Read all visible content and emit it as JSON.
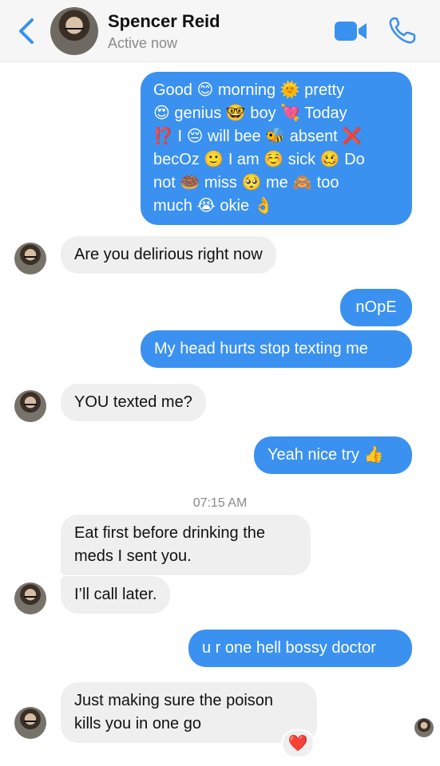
{
  "header": {
    "name": "Spencer Reid",
    "status": "Active now"
  },
  "colors": {
    "accent": "#3a91f0",
    "sent_bubble": "#3a91f0",
    "received_bubble": "#efefef",
    "header_bg": "#f6f6f6",
    "reaction": "#e0282c"
  },
  "icons": {
    "back": "chevron-left-icon",
    "video": "video-camera-icon",
    "call": "phone-icon",
    "reaction": "heart-icon"
  },
  "messages": {
    "m1": {
      "line1": "Good 😊 morning 🌞 pretty",
      "line2": "😍 genius 🤓 boy 💘 Today",
      "line3": "⁉️ I 😔 will bee 🐝 absent ❌",
      "line4": "becOz 🙂 I am ☺️ sick 🥴 Do",
      "line5": "not 🍩 miss 🥺 me 🙈 too",
      "line6": "much 😭 okie 👌"
    },
    "m2": "Are you delirious right now",
    "m3": "nOpE",
    "m4": "My head hurts stop texting me",
    "m5": "YOU texted me?",
    "m6": "Yeah nice try 👍",
    "timestamp": "07:15 AM",
    "m7": {
      "line1": "Eat first before drinking the",
      "line2": "meds I sent you."
    },
    "m8": "I’ll call later.",
    "m9": "u r one hell bossy doctor",
    "m10": {
      "line1": "Just making sure the poison",
      "line2": "kills you in one go"
    },
    "reaction": "❤️"
  }
}
